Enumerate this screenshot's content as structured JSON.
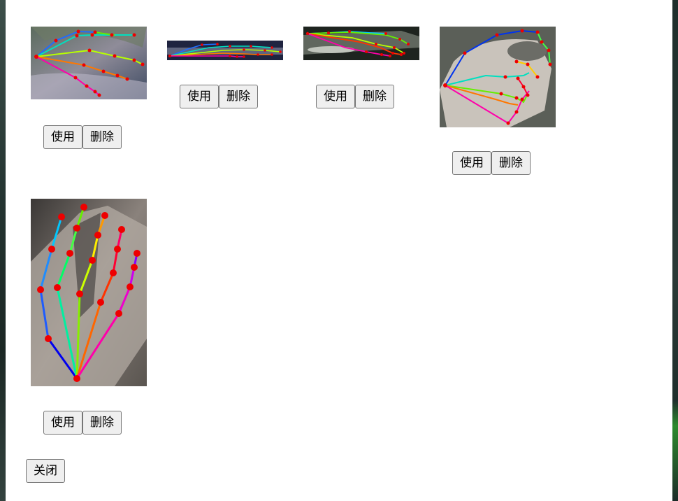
{
  "window": {
    "edge_color": "#2c3a38",
    "accent_green": "#2d8a2c"
  },
  "samples": [
    {
      "use_label": "使用",
      "delete_label": "删除"
    },
    {
      "use_label": "使用",
      "delete_label": "删除"
    },
    {
      "use_label": "使用",
      "delete_label": "删除"
    },
    {
      "use_label": "使用",
      "delete_label": "删除"
    },
    {
      "use_label": "使用",
      "delete_label": "删除"
    }
  ],
  "close_label": "关闭",
  "colors": {
    "keypoint": "#ee0000",
    "thumb_finger": [
      "#0000ee",
      "#1e8cff",
      "#00c8ff"
    ],
    "index_finger": [
      "#00f0a0",
      "#44ff44",
      "#66ee00"
    ],
    "middle_finger": [
      "#66ee00",
      "#ffee00",
      "#ff9900"
    ],
    "ring_finger": [
      "#ff6600",
      "#ff2200",
      "#ff0066"
    ],
    "pinky_finger": [
      "#ff00aa",
      "#ee00cc",
      "#aa00ff"
    ]
  }
}
